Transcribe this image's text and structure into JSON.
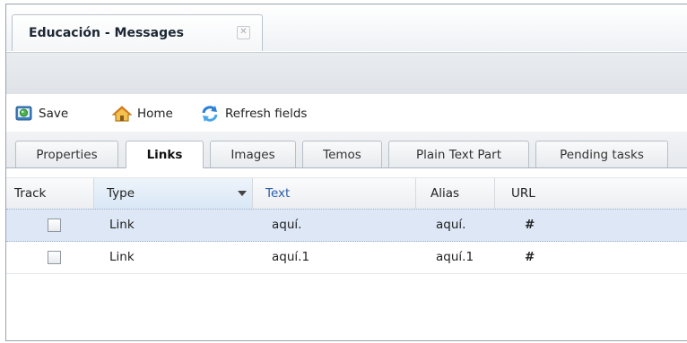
{
  "window": {
    "title": "Educación - Messages",
    "close_symbol": "✕"
  },
  "toolbar": {
    "save_label": "Save",
    "home_label": "Home",
    "refresh_label": "Refresh fields"
  },
  "tabs": [
    {
      "label": "Properties",
      "active": false
    },
    {
      "label": "Links",
      "active": true
    },
    {
      "label": "Images",
      "active": false
    },
    {
      "label": "Temos",
      "active": false
    },
    {
      "label": "Plain Text Part",
      "active": false
    },
    {
      "label": "Pending tasks",
      "active": false
    }
  ],
  "grid": {
    "columns": [
      "Track",
      "Type",
      "Text",
      "Alias",
      "URL"
    ],
    "rows": [
      {
        "track": false,
        "type": "Link",
        "text": "aquí.",
        "alias": "aquí.",
        "url": "#"
      },
      {
        "track": false,
        "type": "Link",
        "text": "aquí.1",
        "alias": "aquí.1",
        "url": "#"
      }
    ]
  },
  "icons": {
    "save": "save-icon",
    "home": "home-icon",
    "refresh": "refresh-icon",
    "close": "close-icon",
    "sort": "chevron-down-icon"
  },
  "colors": {
    "selected_row": "#dde7f6",
    "header_hover": "#d9e7f6",
    "text_column_header": "#2a5fa8"
  }
}
